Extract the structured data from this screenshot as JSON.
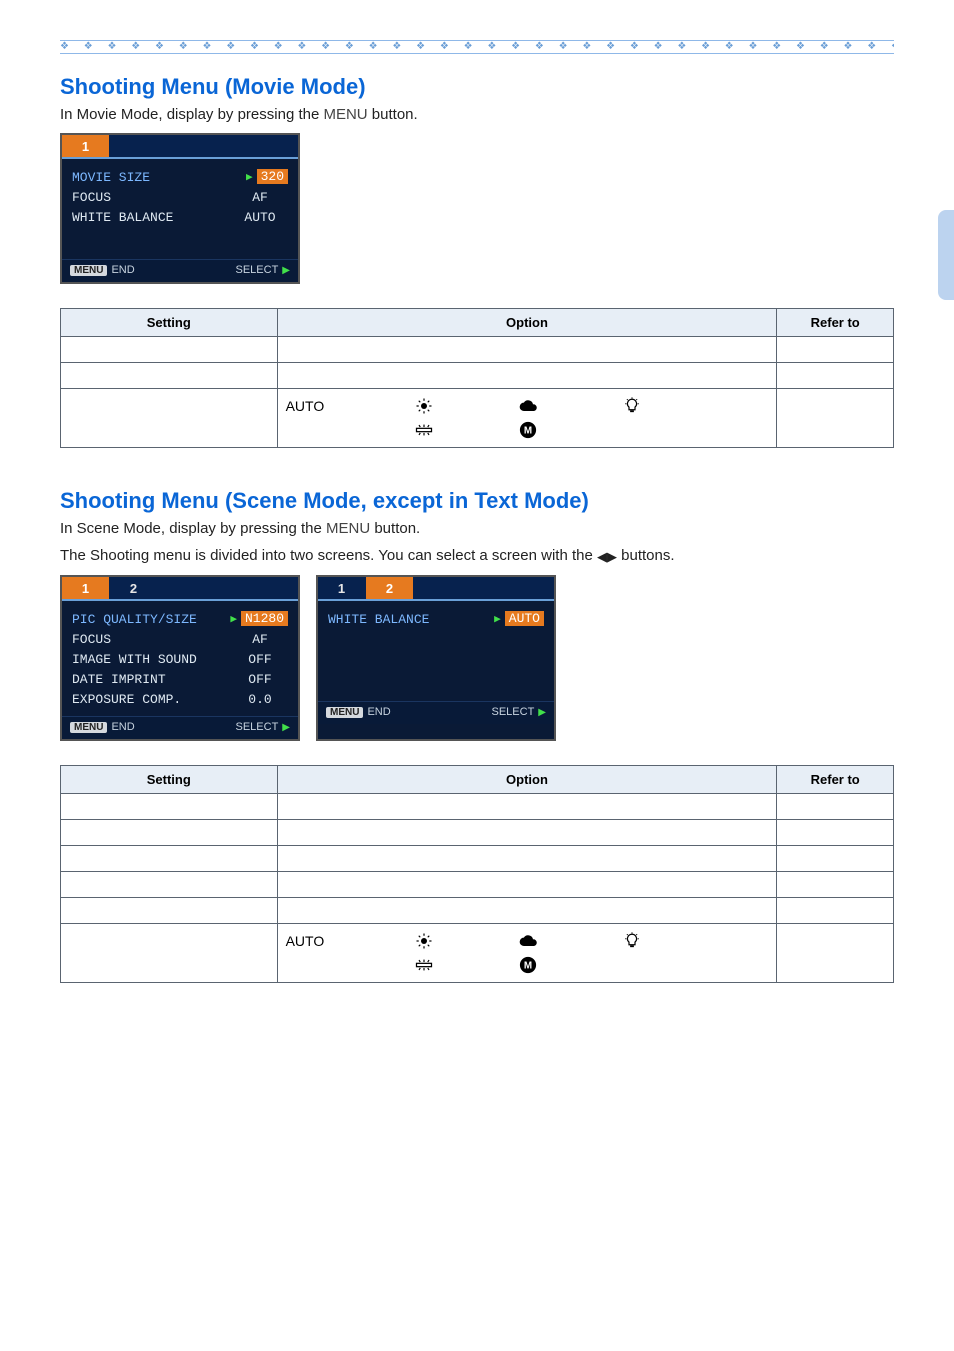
{
  "decor_row": "❖ ❖ ❖ ❖ ❖ ❖ ❖ ❖ ❖ ❖ ❖ ❖ ❖ ❖ ❖ ❖ ❖ ❖ ❖ ❖ ❖ ❖ ❖ ❖ ❖ ❖ ❖ ❖ ❖ ❖ ❖ ❖ ❖ ❖ ❖ ❖ ❖ ❖ ❖ ❖ ❖ ❖ ❖ ❖ ❖ ❖ ❖ ❖ ❖ ❖ ❖ ❖ ❖ ❖ ❖",
  "section1": {
    "heading": "Shooting Menu (Movie Mode)",
    "intro_pre": "In Movie Mode, display by pressing the ",
    "intro_btn": "MENU",
    "intro_post": " button."
  },
  "screen_movie": {
    "tab1": "1",
    "rows": [
      {
        "label": "MOVIE SIZE",
        "value": "320",
        "selected": true
      },
      {
        "label": "FOCUS",
        "value": "AF",
        "selected": false
      },
      {
        "label": "WHITE BALANCE",
        "value": "AUTO",
        "selected": false
      }
    ],
    "footer_menu": "MENU",
    "footer_end": "END",
    "footer_select": "SELECT"
  },
  "table_headers": {
    "setting": "Setting",
    "option": "Option",
    "refer": "Refer to"
  },
  "wb": {
    "auto": "AUTO"
  },
  "section2": {
    "heading": "Shooting Menu (Scene Mode, except in Text Mode)",
    "intro_pre": "In Scene Mode, display by pressing the ",
    "intro_btn": "MENU",
    "intro_post": " button.",
    "body2_pre": "The Shooting menu is divided into two screens. You can select a screen with the ",
    "body2_post": " buttons."
  },
  "screen_scene1": {
    "tab1": "1",
    "tab2": "2",
    "rows": [
      {
        "label": "PIC QUALITY/SIZE",
        "value": "N1280",
        "selected": true
      },
      {
        "label": "FOCUS",
        "value": "AF",
        "selected": false
      },
      {
        "label": "IMAGE WITH SOUND",
        "value": "OFF",
        "selected": false
      },
      {
        "label": "DATE IMPRINT",
        "value": "OFF",
        "selected": false
      },
      {
        "label": "EXPOSURE COMP.",
        "value": "0.0",
        "selected": false
      }
    ],
    "footer_menu": "MENU",
    "footer_end": "END",
    "footer_select": "SELECT"
  },
  "screen_scene2": {
    "tab1": "1",
    "tab2": "2",
    "rows": [
      {
        "label": "WHITE BALANCE",
        "value": "AUTO",
        "selected": true
      }
    ],
    "footer_menu": "MENU",
    "footer_end": "END",
    "footer_select": "SELECT"
  }
}
